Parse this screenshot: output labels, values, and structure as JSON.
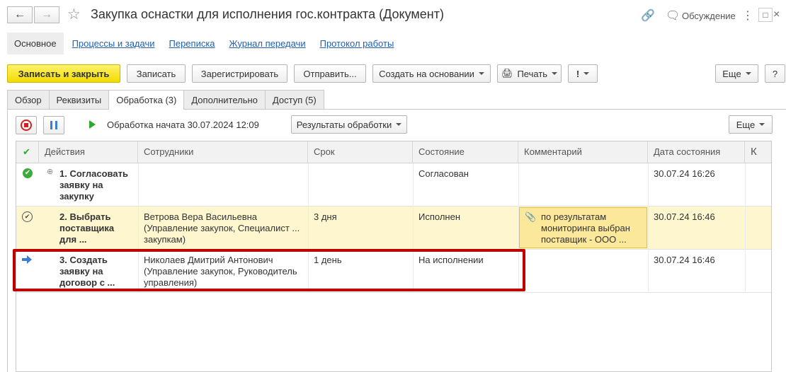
{
  "window": {
    "title": "Закупка оснастки для исполнения гос.контракта (Документ)",
    "discussion_label": "Обсуждение"
  },
  "sections": {
    "active": "Основное",
    "links": [
      "Процессы и задачи",
      "Переписка",
      "Журнал передачи",
      "Протокол работы"
    ]
  },
  "toolbar": {
    "save_close": "Записать и закрыть",
    "save": "Записать",
    "register": "Зарегистрировать",
    "send": "Отправить...",
    "create_based": "Создать на основании",
    "print": "Печать",
    "importance": "!",
    "more": "Еще",
    "help": "?"
  },
  "tabs": [
    "Обзор",
    "Реквизиты",
    "Обработка (3)",
    "Дополнительно",
    "Доступ (5)"
  ],
  "processing": {
    "status": "Обработка начата 30.07.2024 12:09",
    "results_label": "Результаты обработки",
    "more": "Еще"
  },
  "grid": {
    "columns": [
      "Действия",
      "Сотрудники",
      "Срок",
      "Состояние",
      "Комментарий",
      "Дата состояния",
      "К"
    ],
    "rows": [
      {
        "action_lines": [
          "1. Согласовать",
          "заявку на",
          "закупку"
        ],
        "employee_lines": [],
        "term": "",
        "state": "Согласован",
        "comment_lines": [],
        "date": "30.07.24 16:26",
        "icon": "check-green-icon"
      },
      {
        "action_lines": [
          "2. Выбрать",
          "поставщика",
          "для ..."
        ],
        "employee_lines": [
          "Ветрова Вера Васильевна",
          "(Управление закупок, Специалист ...",
          "закупкам)"
        ],
        "term": "3 дня",
        "state": "Исполнен",
        "comment_lines": [
          "по результатам",
          "мониторинга выбран",
          "поставщик - ООО ..."
        ],
        "date": "30.07.24 16:46",
        "icon": "check-circle-icon"
      },
      {
        "action_lines": [
          "3. Создать",
          "заявку на",
          "договор с ..."
        ],
        "employee_lines": [
          "Николаев Дмитрий Антонович",
          "(Управление закупок, Руководитель",
          "управления)"
        ],
        "term": "1 день",
        "state": "На исполнении",
        "comment_lines": [],
        "date": "30.07.24 16:46",
        "icon": "arrow-right-icon"
      }
    ]
  },
  "colors": {
    "accent_yellow": "#f5e000",
    "selected_row": "#fdf6cf",
    "highlight_border": "#c00000",
    "link": "#1f5fb4"
  }
}
